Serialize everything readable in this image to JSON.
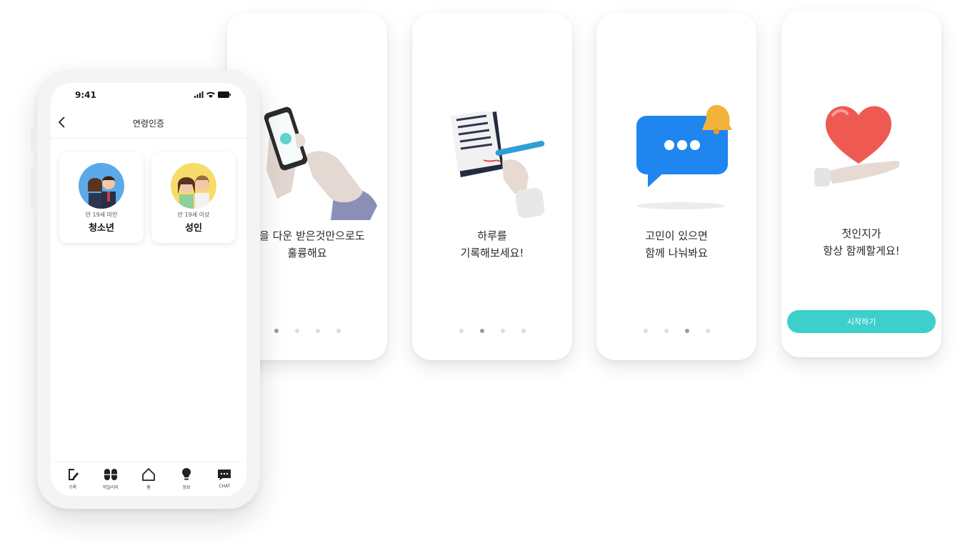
{
  "onboarding": [
    {
      "lines": [
        "앱을 다운 받은것만으로도",
        "훌륭해요"
      ],
      "active_dot": 0
    },
    {
      "lines": [
        "하루를",
        "기록해보세요!"
      ],
      "active_dot": 1
    },
    {
      "lines": [
        "고민이 있으면",
        "함께 나눠봐요"
      ],
      "active_dot": 2
    },
    {
      "lines": [
        "첫인지가",
        "항상 함께할게요!"
      ],
      "button_label": "시작하기"
    }
  ],
  "phone": {
    "status": {
      "time": "9:41"
    },
    "header": {
      "title": "연령인증"
    },
    "options": [
      {
        "sub": "만 19세 미만",
        "main": "청소년"
      },
      {
        "sub": "만 19세 이상",
        "main": "성인"
      }
    ],
    "tabs": [
      {
        "label": "기록",
        "icon": "edit-note-icon"
      },
      {
        "label": "약알리미",
        "icon": "pill-icon"
      },
      {
        "label": "홈",
        "icon": "home-icon"
      },
      {
        "label": "정보",
        "icon": "lightbulb-icon"
      },
      {
        "label": "CHAT",
        "icon": "chat-icon"
      }
    ]
  },
  "colors": {
    "accent": "#3ccfcb",
    "dot_active": "#9a9a9a",
    "dot_inactive": "#dcdcdc"
  }
}
